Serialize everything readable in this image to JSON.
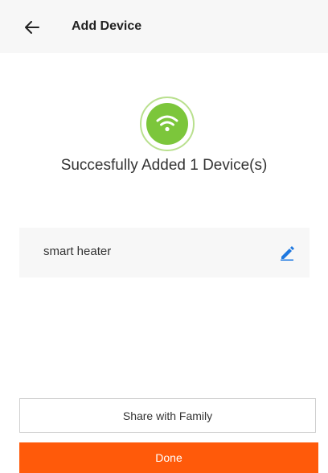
{
  "header": {
    "title": "Add Device",
    "back_icon": "arrow-left-icon"
  },
  "status": {
    "icon": "wifi-icon",
    "message": "Succesfully Added 1 Device(s)"
  },
  "device": {
    "name": "smart heater",
    "edit_icon": "pencil-icon"
  },
  "buttons": {
    "share_label": "Share with Family",
    "done_label": "Done"
  },
  "colors": {
    "accent_green": "#7cc63b",
    "edit_blue": "#1e78e0",
    "done_orange": "#ff5a0a"
  }
}
